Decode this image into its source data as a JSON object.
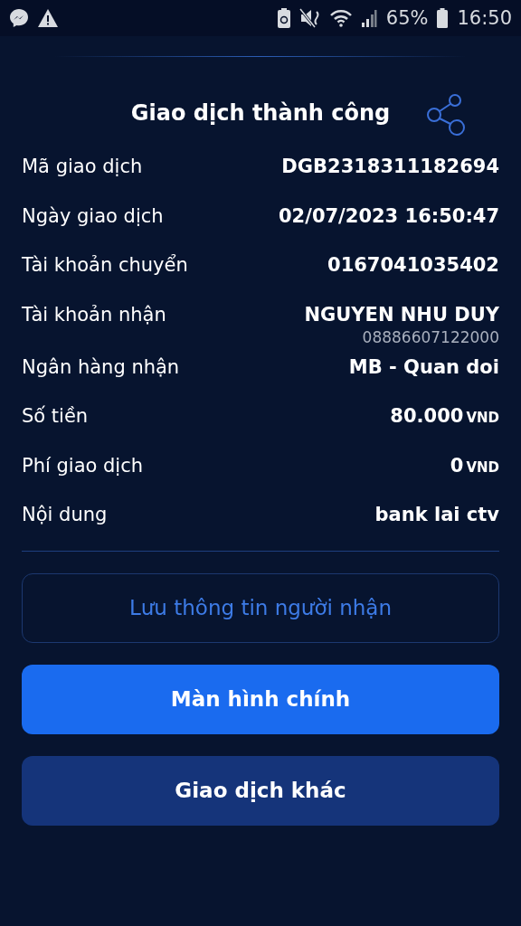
{
  "status_bar": {
    "battery_percent": "65%",
    "time": "16:50"
  },
  "title": "Giao dịch thành công",
  "details": [
    {
      "label": "Mã giao dịch",
      "value": "DGB2318311182694"
    },
    {
      "label": "Ngày giao dịch",
      "value": "02/07/2023 16:50:47"
    },
    {
      "label": "Tài khoản chuyển",
      "value": "0167041035402"
    },
    {
      "label": "Tài khoản nhận",
      "value": "NGUYEN NHU DUY",
      "sub": "08886607122000"
    },
    {
      "label": "Ngân hàng nhận",
      "value": "MB - Quan doi"
    },
    {
      "label": "Số tiền",
      "value": "80.000",
      "unit": "VND"
    },
    {
      "label": "Phí giao dịch",
      "value": "0",
      "unit": "VND"
    },
    {
      "label": "Nội dung",
      "value": "bank lai ctv"
    }
  ],
  "buttons": [
    {
      "label": "Lưu thông tin người nhận",
      "kind": "outline"
    },
    {
      "label": "Màn hình chính",
      "kind": "primary"
    },
    {
      "label": "Giao dịch khác",
      "kind": "secondary"
    }
  ]
}
